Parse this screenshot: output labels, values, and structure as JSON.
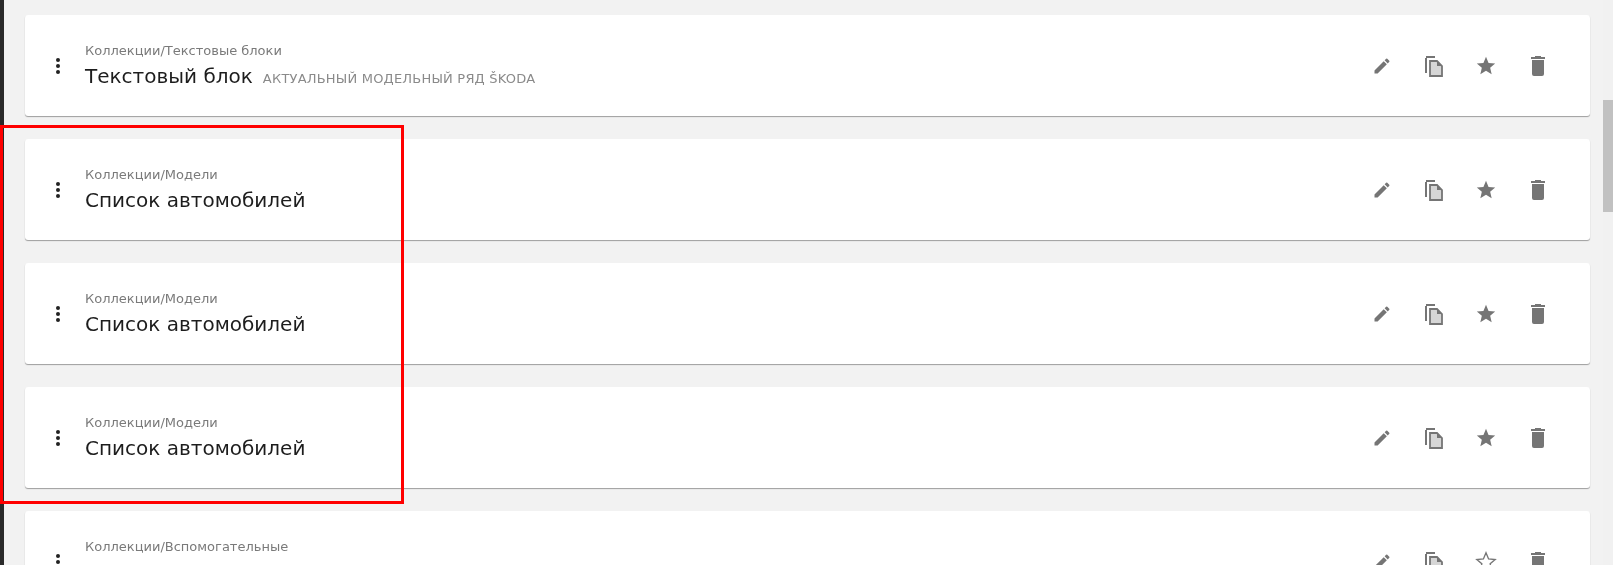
{
  "items": [
    {
      "path": "Коллекции/Текстовые блоки",
      "title": "Текстовый блок",
      "subtitle": "АКТУАЛЬНЫЙ МОДЕЛЬНЫЙ РЯД ŠKODA",
      "favorite": true,
      "highlighted": false
    },
    {
      "path": "Коллекции/Модели",
      "title": "Список автомобилей",
      "favorite": true,
      "highlighted": true
    },
    {
      "path": "Коллекции/Модели",
      "title": "Список автомобилей",
      "favorite": true,
      "highlighted": true
    },
    {
      "path": "Коллекции/Модели",
      "title": "Список автомобилей",
      "favorite": true,
      "highlighted": true
    },
    {
      "path": "Коллекции/Вспомогательные",
      "favorite": false,
      "highlighted": false
    }
  ]
}
